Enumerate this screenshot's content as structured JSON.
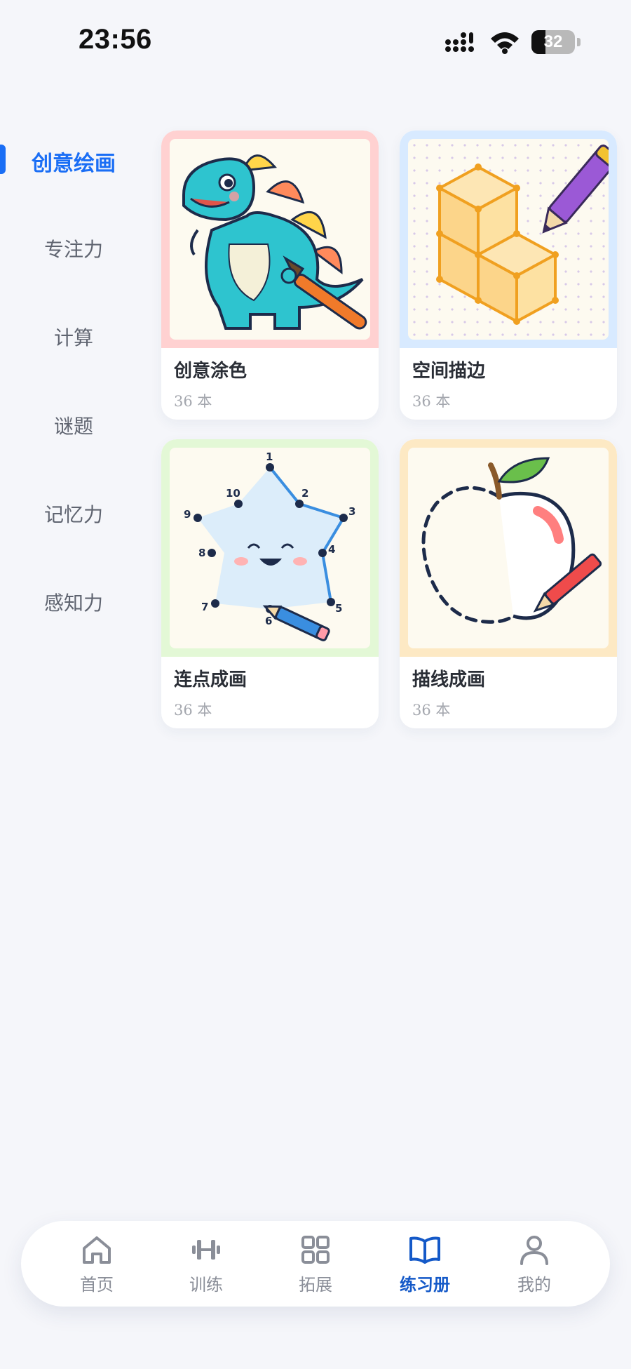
{
  "status_bar": {
    "time": "23:56",
    "battery": "32",
    "battery_level": 0.32,
    "icons": [
      "cellular-signal-icon",
      "wifi-icon",
      "battery-icon"
    ]
  },
  "sidebar": {
    "items": [
      {
        "label": "创意绘画",
        "active": true
      },
      {
        "label": "专注力",
        "active": false
      },
      {
        "label": "计算",
        "active": false
      },
      {
        "label": "谜题",
        "active": false
      },
      {
        "label": "记忆力",
        "active": false
      },
      {
        "label": "感知力",
        "active": false
      }
    ]
  },
  "cards": [
    {
      "title": "创意涂色",
      "count": "36 本",
      "image": "dinosaur-painting-illustration",
      "frame_color": "#ffd1d1"
    },
    {
      "title": "空间描边",
      "count": "36 本",
      "image": "isometric-cubes-pencil-illustration",
      "frame_color": "#d8eaff"
    },
    {
      "title": "连点成画",
      "count": "36 本",
      "image": "connect-dots-star-illustration",
      "frame_color": "#e3f8d6"
    },
    {
      "title": "描线成画",
      "count": "36 本",
      "image": "trace-apple-illustration",
      "frame_color": "#fde9c4"
    }
  ],
  "star_dots": [
    "1",
    "2",
    "3",
    "4",
    "5",
    "6",
    "7",
    "8",
    "9",
    "10"
  ],
  "tabbar": {
    "tabs": [
      {
        "label": "首页",
        "icon": "home-icon",
        "active": false
      },
      {
        "label": "训练",
        "icon": "dumbbell-icon",
        "active": false
      },
      {
        "label": "拓展",
        "icon": "grid-icon",
        "active": false
      },
      {
        "label": "练习册",
        "icon": "book-icon",
        "active": true
      },
      {
        "label": "我的",
        "icon": "person-icon",
        "active": false
      }
    ]
  },
  "colors": {
    "accent": "#1a6ef5",
    "tab_active": "#1459c8",
    "background": "#f5f6fa"
  }
}
